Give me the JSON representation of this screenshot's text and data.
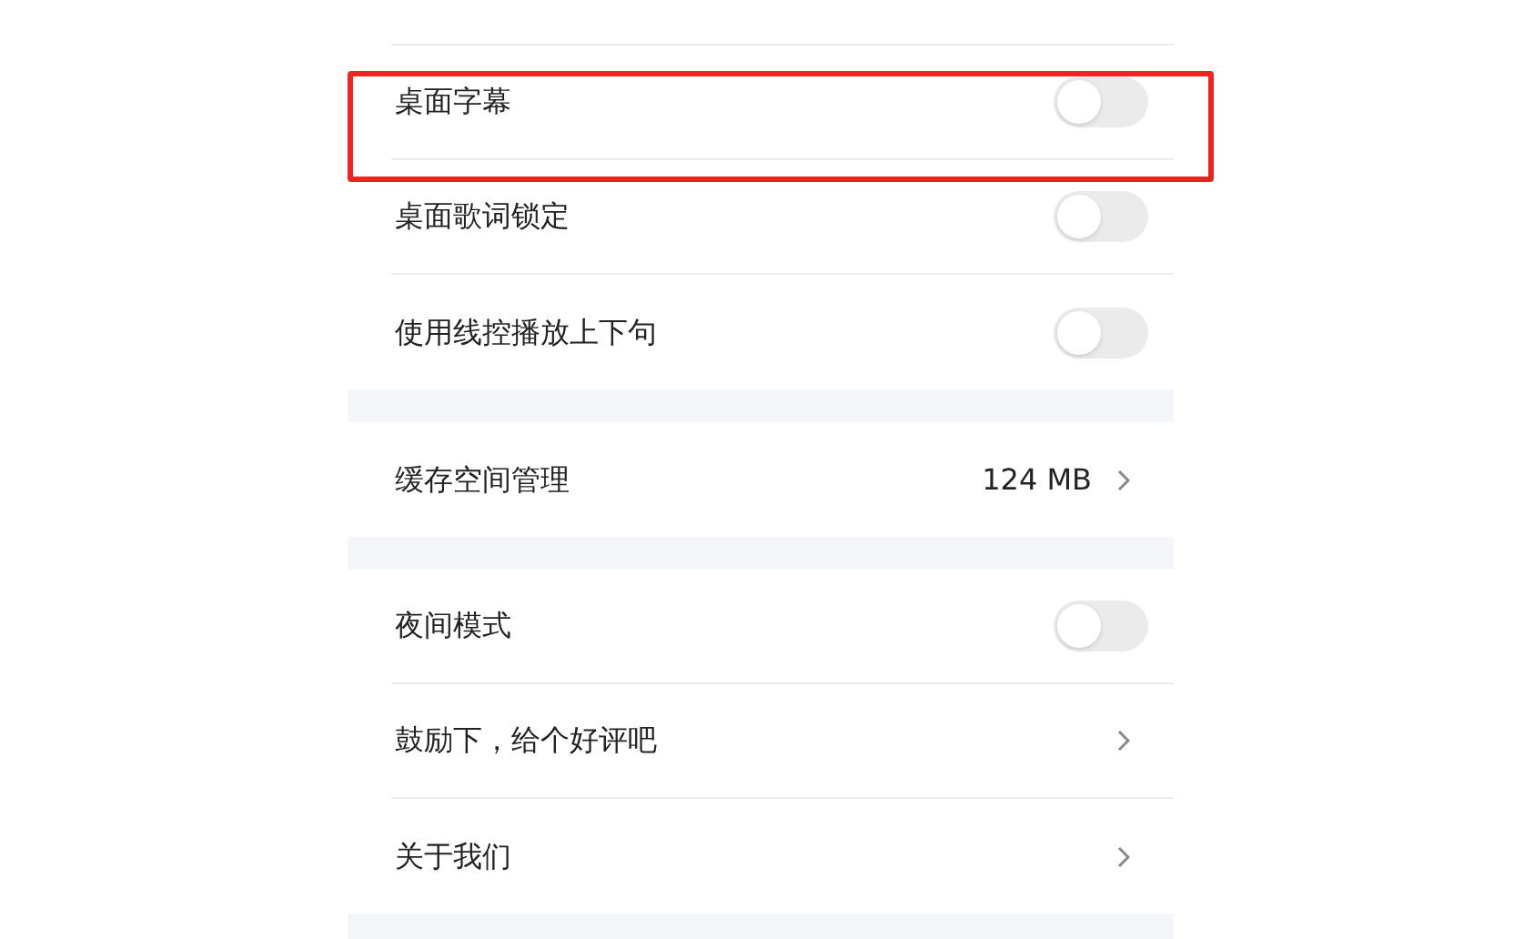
{
  "groups": [
    {
      "items": [
        {
          "kind": "toggle",
          "label": "桌面字幕",
          "on": false,
          "highlighted": true
        },
        {
          "kind": "toggle",
          "label": "桌面歌词锁定",
          "on": false,
          "highlighted": false
        },
        {
          "kind": "toggle",
          "label": "使用线控播放上下句",
          "on": false,
          "highlighted": false
        }
      ]
    },
    {
      "items": [
        {
          "kind": "link",
          "label": "缓存空间管理",
          "value": "124 MB",
          "highlighted": false
        }
      ]
    },
    {
      "items": [
        {
          "kind": "toggle",
          "label": "夜间模式",
          "on": false,
          "highlighted": false
        },
        {
          "kind": "link",
          "label": "鼓励下，给个好评吧",
          "highlighted": false
        },
        {
          "kind": "link",
          "label": "关于我们",
          "highlighted": false
        }
      ]
    }
  ]
}
